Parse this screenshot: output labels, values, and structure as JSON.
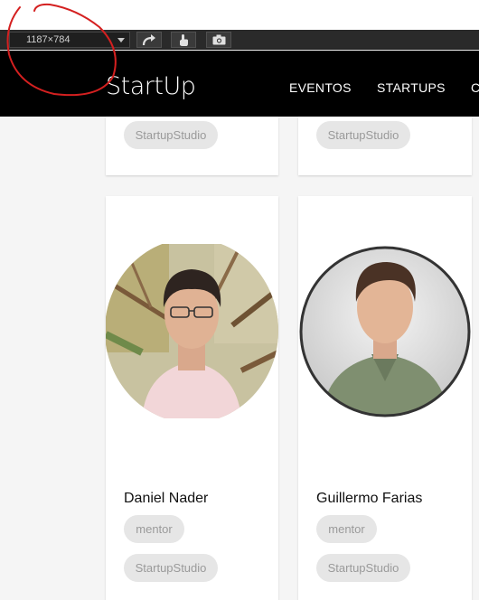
{
  "devtools": {
    "viewport_size": "1187×784",
    "icons": [
      "rotate-icon",
      "touch-icon",
      "camera-icon"
    ]
  },
  "site": {
    "logo": "StartUp",
    "nav": [
      "EVENTOS",
      "STARTUPS",
      "C"
    ]
  },
  "cards_top": [
    {
      "tag": "StartupStudio"
    },
    {
      "tag": "StartupStudio"
    }
  ],
  "people": [
    {
      "name": "Daniel Nader",
      "role_tag": "mentor",
      "org_tag": "StartupStudio"
    },
    {
      "name": "Guillermo Farias",
      "role_tag": "mentor",
      "org_tag": "StartupStudio"
    }
  ],
  "colors": {
    "header_bg": "#000000",
    "page_bg": "#f5f5f5",
    "tag_bg": "#e6e6e6",
    "annotation": "#d42020"
  }
}
